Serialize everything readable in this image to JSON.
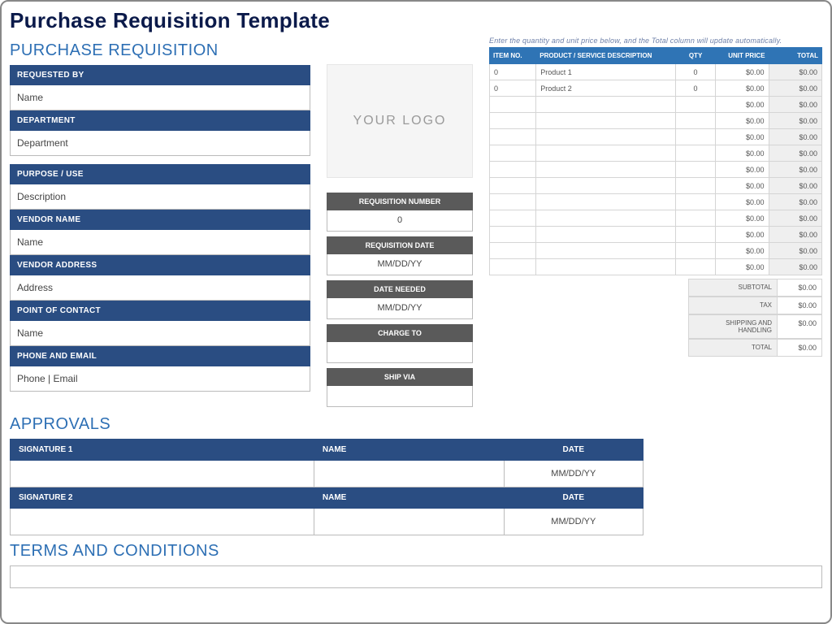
{
  "title": "Purchase Requisition Template",
  "headings": {
    "main": "PURCHASE REQUISITION",
    "approvals": "APPROVALS",
    "terms": "TERMS AND CONDITIONS"
  },
  "logo_text": "YOUR LOGO",
  "left": {
    "requested_by_label": "REQUESTED BY",
    "requested_by_value": "Name",
    "department_label": "DEPARTMENT",
    "department_value": "Department",
    "purpose_label": "PURPOSE / USE",
    "purpose_value": "Description",
    "vendor_name_label": "VENDOR NAME",
    "vendor_name_value": "Name",
    "vendor_address_label": "VENDOR ADDRESS",
    "vendor_address_value": "Address",
    "poc_label": "POINT OF CONTACT",
    "poc_value": "Name",
    "phone_email_label": "PHONE AND EMAIL",
    "phone_email_value": "Phone   |   Email"
  },
  "mid": {
    "req_no_label": "REQUISITION NUMBER",
    "req_no_value": "0",
    "req_date_label": "REQUISITION DATE",
    "req_date_value": "MM/DD/YY",
    "date_needed_label": "DATE NEEDED",
    "date_needed_value": "MM/DD/YY",
    "charge_to_label": "CHARGE TO",
    "charge_to_value": "",
    "ship_via_label": "SHIP VIA",
    "ship_via_value": ""
  },
  "items": {
    "hint": "Enter the quantity and unit price below, and the Total column will update automatically.",
    "headers": {
      "item_no": "ITEM NO.",
      "desc": "PRODUCT / SERVICE DESCRIPTION",
      "qty": "QTY",
      "unit": "UNIT PRICE",
      "total": "TOTAL"
    },
    "rows": [
      {
        "item_no": "0",
        "desc": "Product 1",
        "qty": "0",
        "unit": "$0.00",
        "total": "$0.00"
      },
      {
        "item_no": "0",
        "desc": "Product 2",
        "qty": "0",
        "unit": "$0.00",
        "total": "$0.00"
      },
      {
        "item_no": "",
        "desc": "",
        "qty": "",
        "unit": "$0.00",
        "total": "$0.00"
      },
      {
        "item_no": "",
        "desc": "",
        "qty": "",
        "unit": "$0.00",
        "total": "$0.00"
      },
      {
        "item_no": "",
        "desc": "",
        "qty": "",
        "unit": "$0.00",
        "total": "$0.00"
      },
      {
        "item_no": "",
        "desc": "",
        "qty": "",
        "unit": "$0.00",
        "total": "$0.00"
      },
      {
        "item_no": "",
        "desc": "",
        "qty": "",
        "unit": "$0.00",
        "total": "$0.00"
      },
      {
        "item_no": "",
        "desc": "",
        "qty": "",
        "unit": "$0.00",
        "total": "$0.00"
      },
      {
        "item_no": "",
        "desc": "",
        "qty": "",
        "unit": "$0.00",
        "total": "$0.00"
      },
      {
        "item_no": "",
        "desc": "",
        "qty": "",
        "unit": "$0.00",
        "total": "$0.00"
      },
      {
        "item_no": "",
        "desc": "",
        "qty": "",
        "unit": "$0.00",
        "total": "$0.00"
      },
      {
        "item_no": "",
        "desc": "",
        "qty": "",
        "unit": "$0.00",
        "total": "$0.00"
      },
      {
        "item_no": "",
        "desc": "",
        "qty": "",
        "unit": "$0.00",
        "total": "$0.00"
      }
    ],
    "totals": {
      "subtotal_label": "SUBTOTAL",
      "subtotal": "$0.00",
      "tax_label": "TAX",
      "tax": "$0.00",
      "ship_label": "SHIPPING AND HANDLING",
      "ship": "$0.00",
      "total_label": "TOTAL",
      "total": "$0.00"
    }
  },
  "approvals": {
    "sig1_label": "SIGNATURE 1",
    "name_label": "NAME",
    "date_label": "DATE",
    "sig2_label": "SIGNATURE 2",
    "date_placeholder": "MM/DD/YY"
  }
}
